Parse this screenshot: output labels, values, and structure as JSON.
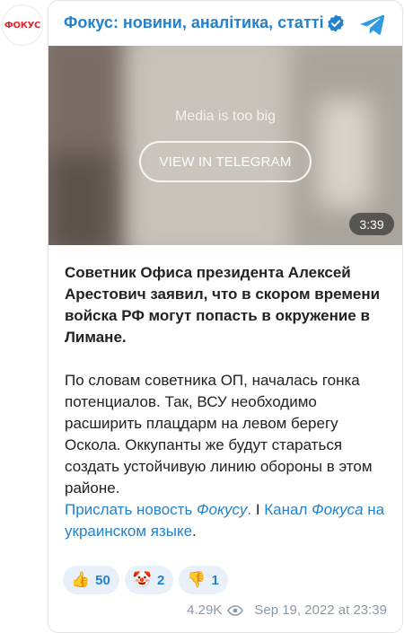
{
  "avatar": {
    "text": "ФОКУС"
  },
  "channel": {
    "name": "Фокус: новини, аналітика, статті"
  },
  "media": {
    "notice": "Media is too big",
    "button_label": "VIEW IN TELEGRAM",
    "duration": "3:39"
  },
  "post": {
    "headline": "Советник Офиса президента Алексей Арестович заявил, что в скором времени войска РФ могут попасть в окружение в Лимане.",
    "body": "По словам советника ОП, началась гонка потенциалов. Так, ВСУ необходимо расширить плацдарм на левом берегу Оскола. Оккупанты же будут стараться создать устойчивую линию обороны в этом районе.",
    "links": {
      "send_part1": "Прислать новость ",
      "send_part2": "Фокусу",
      "send_part3": ".",
      "separator": " I ",
      "channel_part1": "Канал ",
      "channel_part2": "Фокуса",
      "channel_part3": " на украинском языке",
      "channel_part4": "."
    }
  },
  "reactions": [
    {
      "emoji": "👍",
      "icon": "thumbs-up-icon",
      "count": "50"
    },
    {
      "emoji": "🤡",
      "icon": "clown-face-icon",
      "count": "2"
    },
    {
      "emoji": "👎",
      "icon": "thumbs-down-icon",
      "count": "1"
    }
  ],
  "footer": {
    "views": "4.29K",
    "date": "Sep 19, 2022 at 23:39"
  },
  "colors": {
    "link": "#2481cc",
    "text": "#222222",
    "meta": "#8a9aa8",
    "reaction_bg": "#e8f0f9",
    "brand_red": "#e1262d"
  }
}
